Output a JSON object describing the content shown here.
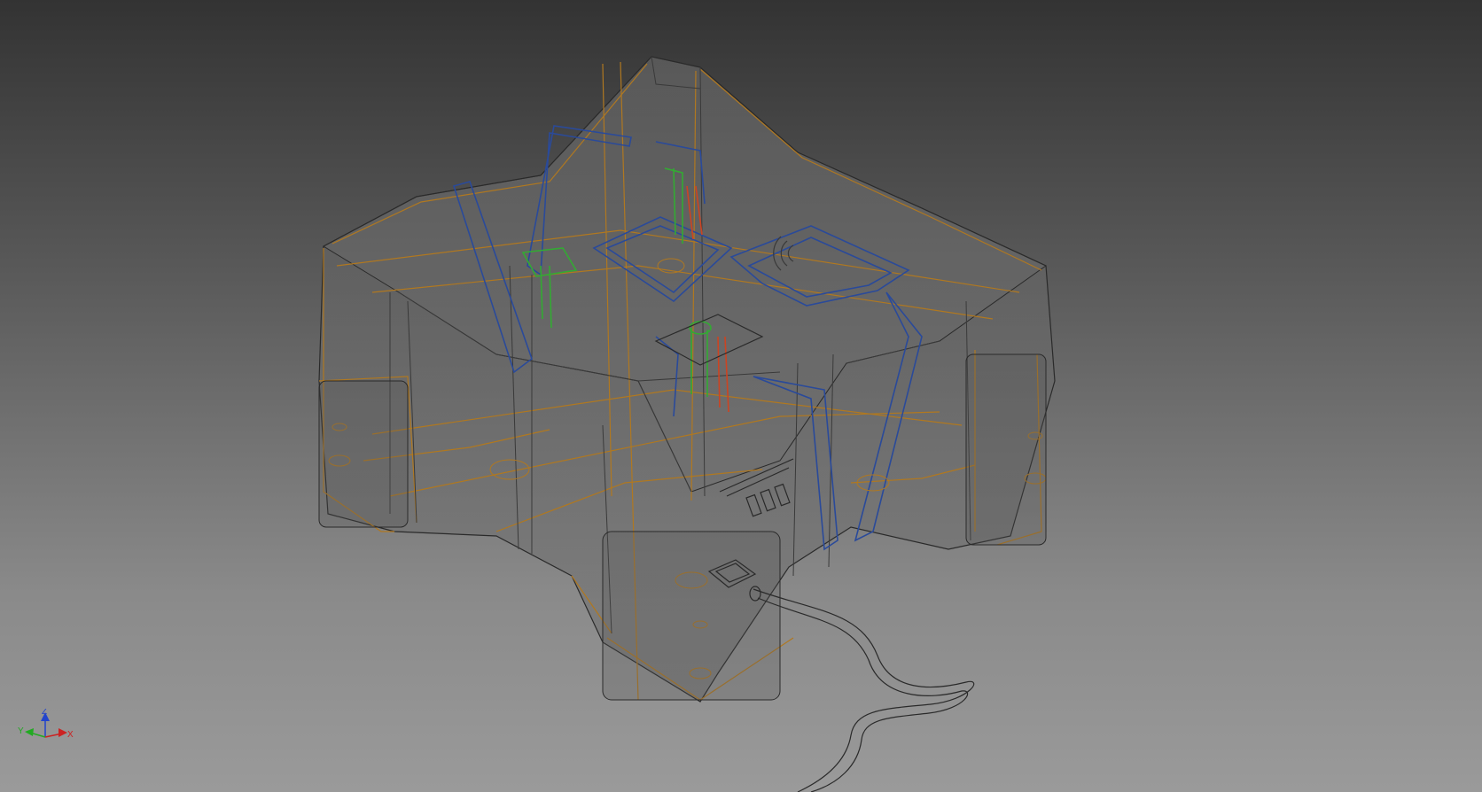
{
  "viewport": {
    "background_top": "#333333",
    "background_bottom": "#9a9a9a",
    "display_mode": "wireframe-transparent"
  },
  "model": {
    "edge_colors": {
      "housing": "#b07820",
      "frame": "#2a4a9a",
      "components_green": "#33aa33",
      "components_red": "#cc4422",
      "silhouette": "#2a2a2a"
    }
  },
  "view_triad": {
    "axes": [
      {
        "name": "Z",
        "label": "Z",
        "color": "#2244cc"
      },
      {
        "name": "X",
        "label": "X",
        "color": "#cc2222"
      },
      {
        "name": "Y",
        "label": "Y",
        "color": "#22aa22"
      }
    ]
  }
}
